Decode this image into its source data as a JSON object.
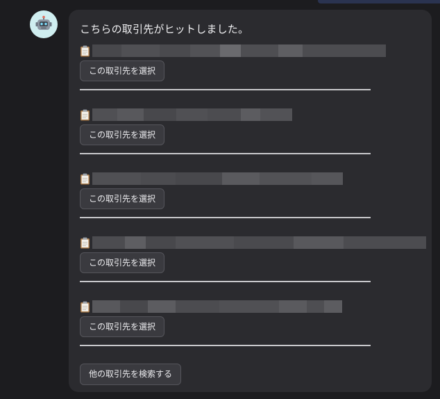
{
  "message": {
    "text": "こちらの取引先がヒットしました。"
  },
  "entries": [
    {
      "name_icon": "clipboard-icon",
      "button_label": "この取引先を選択"
    },
    {
      "name_icon": "clipboard-icon",
      "button_label": "この取引先を選択"
    },
    {
      "name_icon": "clipboard-icon",
      "button_label": "この取引先を選択"
    },
    {
      "name_icon": "clipboard-icon",
      "button_label": "この取引先を選択"
    },
    {
      "name_icon": "clipboard-icon",
      "button_label": "この取引先を選択"
    }
  ],
  "footer": {
    "search_other_label": "他の取引先を検索する"
  },
  "avatar": {
    "icon": "robot-icon",
    "color": "#cfeef0"
  },
  "colors": {
    "page_bg": "#1c1c1f",
    "bubble_bg": "#2b2b2f",
    "button_bg": "#3a3a3f",
    "separator": "#c9c9cc"
  }
}
